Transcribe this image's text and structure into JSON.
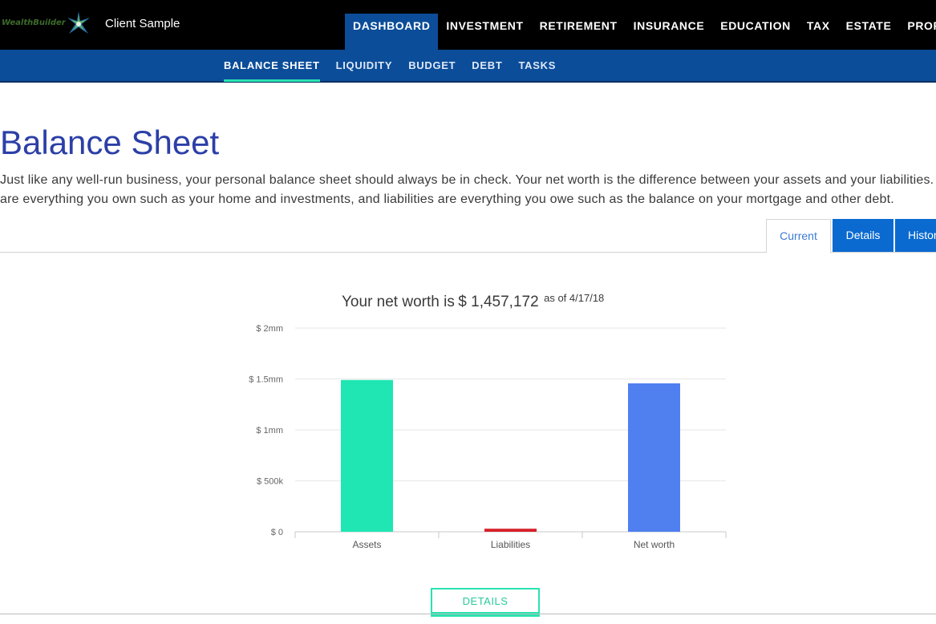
{
  "header": {
    "logo_text": "WealthBuilder",
    "client_name": "Client Sample",
    "nav": [
      {
        "label": "DASHBOARD",
        "active": true
      },
      {
        "label": "INVESTMENT",
        "active": false
      },
      {
        "label": "RETIREMENT",
        "active": false
      },
      {
        "label": "INSURANCE",
        "active": false
      },
      {
        "label": "EDUCATION",
        "active": false
      },
      {
        "label": "TAX",
        "active": false
      },
      {
        "label": "ESTATE",
        "active": false
      },
      {
        "label": "PROFILE",
        "active": false
      }
    ]
  },
  "subnav": [
    {
      "label": "BALANCE SHEET",
      "active": true
    },
    {
      "label": "LIQUIDITY",
      "active": false
    },
    {
      "label": "BUDGET",
      "active": false
    },
    {
      "label": "DEBT",
      "active": false
    },
    {
      "label": "TASKS",
      "active": false
    }
  ],
  "page": {
    "title": "Balance Sheet",
    "intro_line1": "Just like any well-run business, your personal balance sheet should always be in check. Your net worth is the difference between your assets and your liabilities. A",
    "intro_line2": "are everything you own such as your home and investments, and liabilities are everything you owe such as the balance on your mortgage and other debt."
  },
  "tabs": [
    {
      "label": "Current",
      "active": true
    },
    {
      "label": "Details",
      "active": false
    },
    {
      "label": "Histor",
      "active": false
    }
  ],
  "net_worth": {
    "prefix": "Your net worth is",
    "amount": "$ 1,457,172",
    "as_of": "as of 4/17/18"
  },
  "chart_data": {
    "type": "bar",
    "categories": [
      "Assets",
      "Liabilities",
      "Net worth"
    ],
    "values": [
      1490000,
      30000,
      1457172
    ],
    "bar_colors": [
      "#1fe6b2",
      "#d6202a",
      "#5080f0"
    ],
    "y_ticks": [
      {
        "value": 0,
        "label": "$ 0"
      },
      {
        "value": 500000,
        "label": "$ 500k"
      },
      {
        "value": 1000000,
        "label": "$ 1mm"
      },
      {
        "value": 1500000,
        "label": "$ 1.5mm"
      },
      {
        "value": 2000000,
        "label": "$ 2mm"
      }
    ],
    "ylim": [
      0,
      2000000
    ],
    "grid": true
  },
  "details_button": "DETAILS",
  "colors": {
    "nav_bg": "#000000",
    "subnav_bg": "#0b4d99",
    "accent": "#29e3b0",
    "title": "#2c3fa8",
    "tab_active_bg": "#0a6ad0"
  }
}
